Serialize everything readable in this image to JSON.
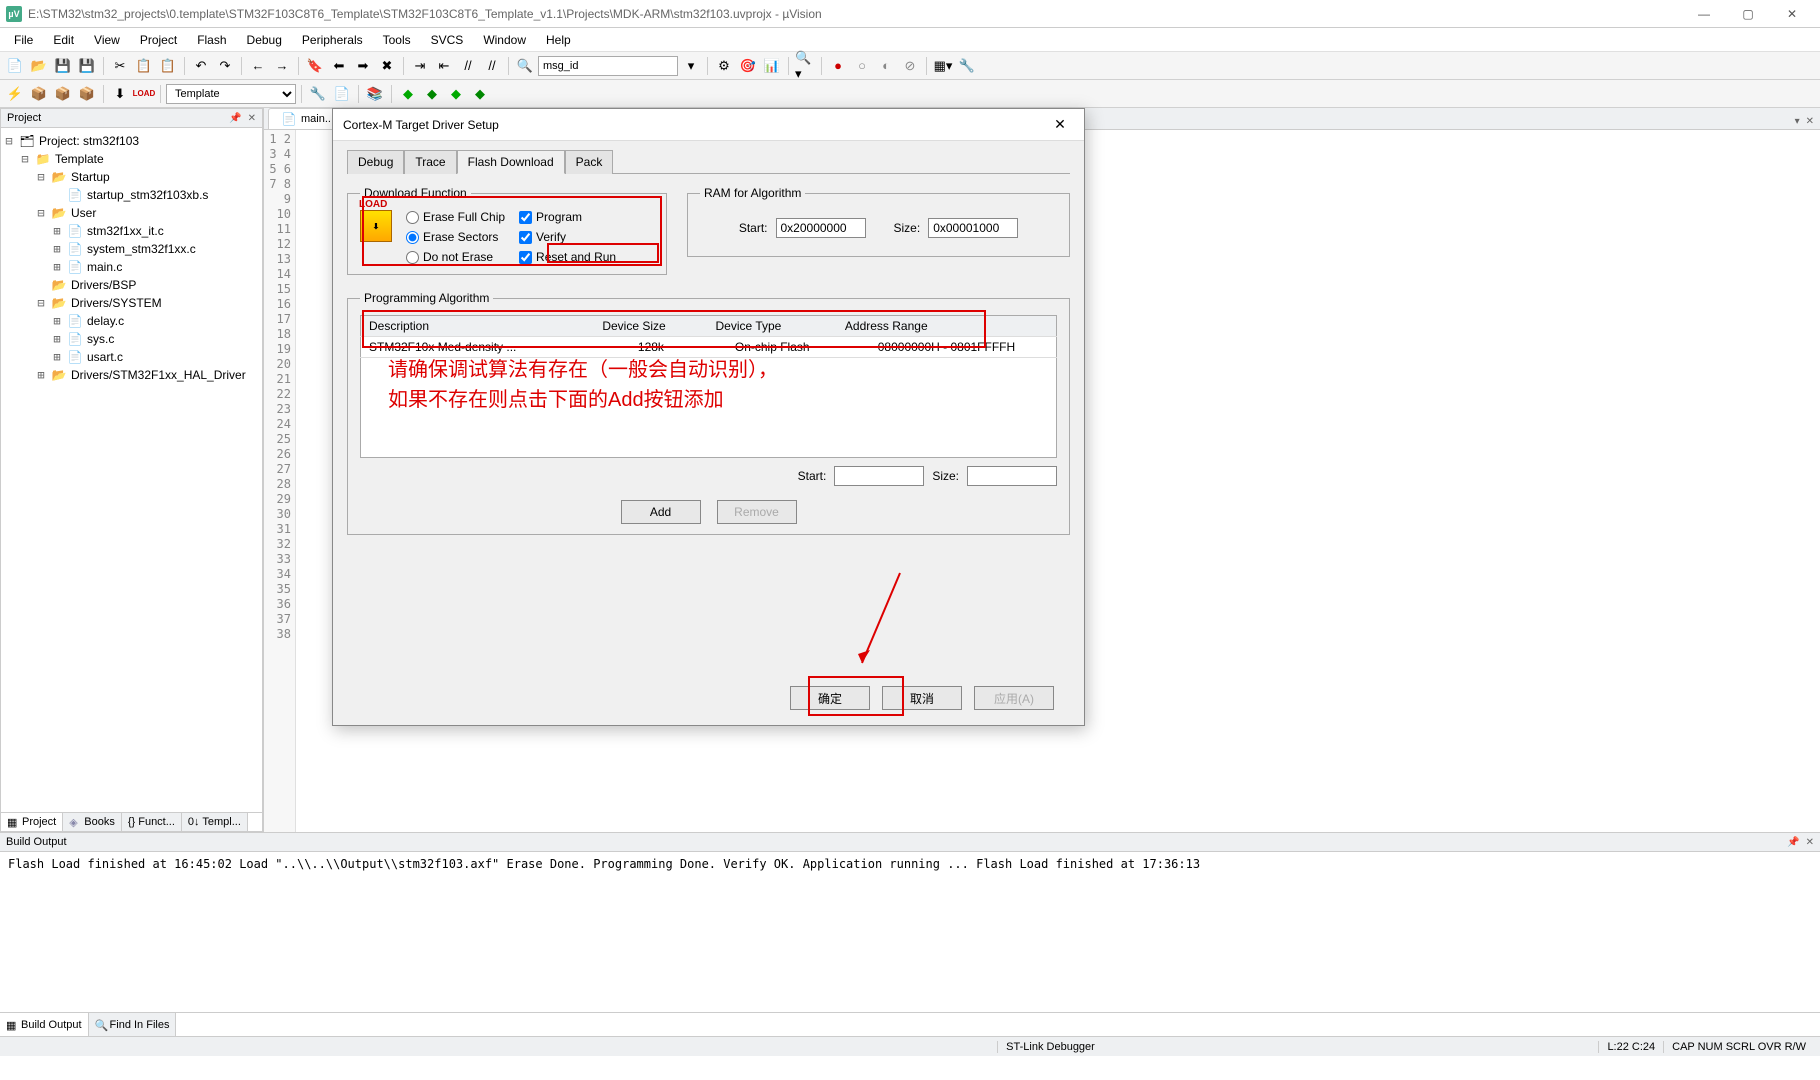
{
  "title": "E:\\STM32\\stm32_projects\\0.template\\STM32F103C8T6_Template\\STM32F103C8T6_Template_v1.1\\Projects\\MDK-ARM\\stm32f103.uvprojx - µVision",
  "menu": [
    "File",
    "Edit",
    "View",
    "Project",
    "Flash",
    "Debug",
    "Peripherals",
    "Tools",
    "SVCS",
    "Window",
    "Help"
  ],
  "toolbar1_search": "msg_id",
  "toolbar2_target": "Template",
  "project": {
    "header": "Project",
    "root": "Project: stm32f103",
    "template": "Template",
    "groups": [
      {
        "name": "Startup",
        "files": [
          "startup_stm32f103xb.s"
        ]
      },
      {
        "name": "User",
        "files": [
          "stm32f1xx_it.c",
          "system_stm32f1xx.c",
          "main.c"
        ]
      },
      {
        "name": "Drivers/BSP",
        "files": []
      },
      {
        "name": "Drivers/SYSTEM",
        "files": [
          "delay.c",
          "sys.c",
          "usart.c"
        ]
      },
      {
        "name": "Drivers/STM32F1xx_HAL_Driver",
        "files": []
      }
    ],
    "tabs": [
      "Project",
      "Books",
      "{} Funct...",
      "0↓ Templ..."
    ]
  },
  "editor_tab": "main...",
  "line_numbers_max": 38,
  "dialog": {
    "title": "Cortex-M Target Driver Setup",
    "tabs": [
      "Debug",
      "Trace",
      "Flash Download",
      "Pack"
    ],
    "active_tab": 2,
    "download_legend": "Download Function",
    "radios": [
      "Erase Full Chip",
      "Erase Sectors",
      "Do not Erase"
    ],
    "radio_selected": 1,
    "checks": [
      {
        "label": "Program",
        "checked": true
      },
      {
        "label": "Verify",
        "checked": true
      },
      {
        "label": "Reset and Run",
        "checked": true
      }
    ],
    "ram_legend": "RAM for Algorithm",
    "ram_start_label": "Start:",
    "ram_start": "0x20000000",
    "ram_size_label": "Size:",
    "ram_size": "0x00001000",
    "alg_legend": "Programming Algorithm",
    "alg_headers": [
      "Description",
      "Device Size",
      "Device Type",
      "Address Range"
    ],
    "alg_row": [
      "STM32F10x Med-density ...",
      "128k",
      "On-chip Flash",
      "08000000H - 0801FFFFH"
    ],
    "alg_start_label": "Start:",
    "alg_size_label": "Size:",
    "add_btn": "Add",
    "remove_btn": "Remove",
    "ok_btn": "确定",
    "cancel_btn": "取消",
    "apply_btn": "应用(A)"
  },
  "annotation": {
    "line1": "请确保调试算法有存在（一般会自动识别），",
    "line2": "如果不存在则点击下面的Add按钮添加"
  },
  "build": {
    "header": "Build Output",
    "lines": [
      "Flash Load finished at 16:45:02",
      "Load \"..\\\\..\\\\Output\\\\stm32f103.axf\"",
      "Erase Done.",
      "Programming Done.",
      "Verify OK.",
      "Application running ...",
      "Flash Load finished at 17:36:13"
    ],
    "tabs": [
      "Build Output",
      "Find In Files"
    ]
  },
  "status": {
    "debugger": "ST-Link Debugger",
    "cursor": "L:22 C:24",
    "caps": "CAP NUM SCRL OVR R/W"
  }
}
